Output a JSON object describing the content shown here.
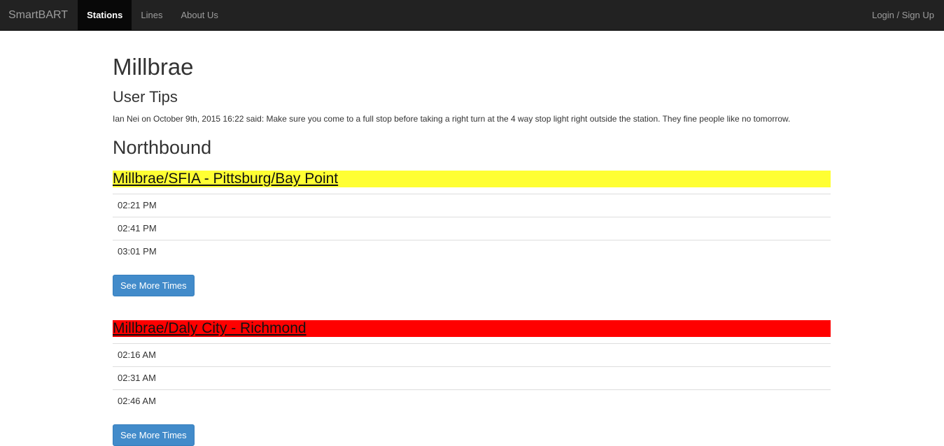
{
  "nav": {
    "brand": "SmartBART",
    "items": [
      {
        "label": "Stations",
        "active": true
      },
      {
        "label": "Lines",
        "active": false
      },
      {
        "label": "About Us",
        "active": false
      }
    ],
    "login": "Login / Sign Up"
  },
  "station": {
    "name": "Millbrae",
    "tips_title": "User Tips",
    "tip": "Ian Nei on October 9th, 2015 16:22 said: Make sure you come to a full stop before taking a right turn at the 4 way stop light right outside the station. They fine people like no tomorrow.",
    "direction": "Northbound"
  },
  "lines": [
    {
      "name": "Millbrae/SFIA - Pittsburg/Bay Point",
      "color": "#ffff33",
      "times": [
        "02:21 PM",
        "02:41 PM",
        "03:01 PM"
      ],
      "button": "See More Times"
    },
    {
      "name": "Millbrae/Daly City - Richmond",
      "color": "#ff0000",
      "times": [
        "02:16 AM",
        "02:31 AM",
        "02:46 AM"
      ],
      "button": "See More Times"
    }
  ]
}
